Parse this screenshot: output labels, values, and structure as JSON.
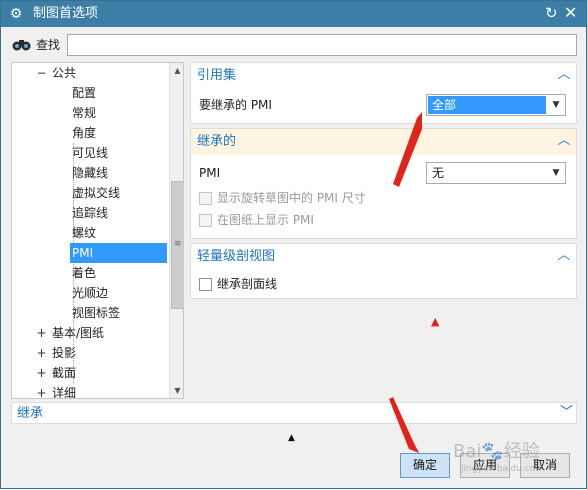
{
  "window": {
    "title": "制图首选项",
    "icons": {
      "settings": "gear-icon",
      "reset": "reset-icon",
      "close": "close-icon"
    }
  },
  "search": {
    "label": "查找",
    "value": "",
    "placeholder": ""
  },
  "tree": {
    "items": [
      {
        "label": "公共",
        "expander": "−"
      },
      {
        "label": "配置"
      },
      {
        "label": "常规"
      },
      {
        "label": "角度"
      },
      {
        "label": "可见线"
      },
      {
        "label": "隐藏线"
      },
      {
        "label": "虚拟交线"
      },
      {
        "label": "追踪线"
      },
      {
        "label": "螺纹"
      },
      {
        "label": "PMI",
        "selected": true
      },
      {
        "label": "着色"
      },
      {
        "label": "光顺边"
      },
      {
        "label": "视图标签"
      },
      {
        "label": "基本/图纸",
        "expander": "+"
      },
      {
        "label": "投影",
        "expander": "+"
      },
      {
        "label": "截面",
        "expander": "+"
      },
      {
        "label": "详细",
        "expander": "+"
      }
    ]
  },
  "panels": {
    "reference_set": {
      "title": "引用集",
      "field_label": "要继承的 PMI",
      "field_value": "全部"
    },
    "inherited": {
      "title": "继承的",
      "pmi_label": "PMI",
      "pmi_value": "无",
      "option1": "显示旋转草图中的 PMI 尺寸",
      "option2": "在图纸上显示 PMI"
    },
    "section_view": {
      "title": "轻量级剖视图",
      "option1": "继承剖面线"
    }
  },
  "inherit_bar": {
    "title": "继承"
  },
  "buttons": {
    "ok": "确定",
    "apply": "应用",
    "cancel": "取消"
  },
  "watermark": {
    "text": "Bai🐾经验",
    "sub": "jingyan.baidu.com"
  },
  "colors": {
    "titlebar": "#3d7ea6",
    "accent": "#1c75bc",
    "selection": "#3399ff",
    "annotation": "#e2231a",
    "panel_highlight": "#fdf5e1"
  }
}
